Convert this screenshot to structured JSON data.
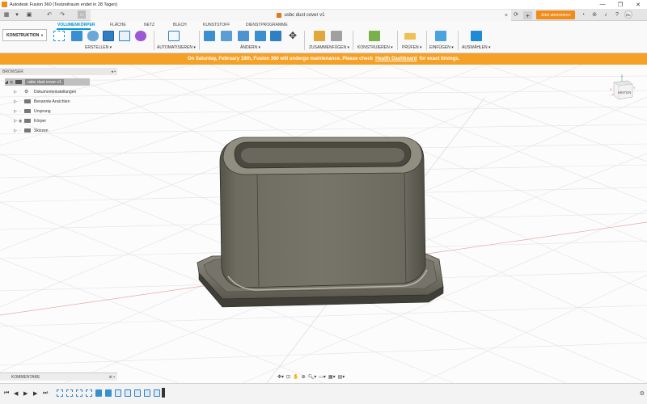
{
  "window": {
    "title": "Autodesk Fusion 360 (Testzeitraum endet in 28 Tagen)",
    "minimize": "—",
    "maximize": "❐",
    "close": "✕"
  },
  "tabs": {
    "document_title": "usbc dust cover v1",
    "new_tab": "+",
    "subscribe_label": "Jetzt abonnieren",
    "avatar_initials": "DL"
  },
  "ribbon": {
    "workspace": "KONSTRUKTION",
    "tabs": [
      "VOLUMENKÖRPER",
      "FLÄCHE",
      "NETZ",
      "BLECH",
      "KUNSTSTOFF",
      "DIENSTPROGRAMME"
    ],
    "groups": [
      "ERSTELLEN ▾",
      "AUTOMATISIEREN ▾",
      "ÄNDERN ▾",
      "ZUSAMMENFÜGEN ▾",
      "KONSTRUIEREN ▾",
      "PRÜFEN ▾",
      "EINFÜGEN ▾",
      "AUSWÄHLEN ▾"
    ]
  },
  "banner": {
    "text_before": "On Saturday, February 18th, Fusion 360 will undergo maintenance. Please check",
    "link": "Health Dashboard",
    "text_after": "for exact timings."
  },
  "browser": {
    "header": "BROWSER",
    "root": "usbc dust cover v1",
    "items": [
      "Dokumenteinstellungen",
      "Benannte Ansichten",
      "Ursprung",
      "Körper",
      "Skizzen"
    ]
  },
  "comments": {
    "label": "KOMMENTARE"
  },
  "viewcube": {
    "face_label": "HINTEN",
    "axis_x": "X",
    "axis_y": "Y",
    "axis_z": "Z"
  },
  "colors": {
    "accent": "#0696d7",
    "banner": "#f5a127",
    "subscribe": "#f28c18",
    "model": "#6f6d5f"
  },
  "icons": {
    "app": "fusion-app-icon",
    "grid_menu": "app-grid-icon",
    "save": "save-icon",
    "undo": "undo-icon",
    "redo": "redo-icon",
    "home": "home-icon",
    "help": "help-icon",
    "notifications": "bell-icon",
    "settings": "gear-icon"
  }
}
